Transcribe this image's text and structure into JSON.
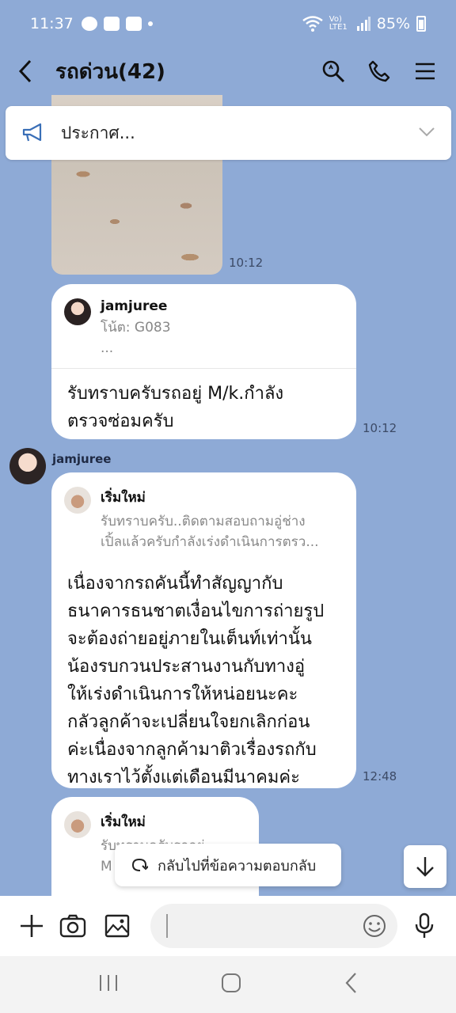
{
  "status_bar": {
    "time": "11:37",
    "battery": "85%",
    "network": "Vo) LTE1"
  },
  "header": {
    "title": "รถด่วน(42)",
    "icons": [
      "back-icon",
      "search-icon",
      "phone-icon",
      "menu-icon"
    ]
  },
  "announcement": {
    "label": "ประกาศ..."
  },
  "messages": [
    {
      "type": "image",
      "time": "10:12"
    },
    {
      "type": "reply",
      "reply_to": {
        "name": "jamjuree",
        "snippet_line1": "โน้ต: G083",
        "snippet_line2": "..."
      },
      "text_line1": "รับทราบครับรถอยู่ M/k.กำลัง",
      "text_line2": "ตรวจซ่อมครับ",
      "time": "10:12"
    },
    {
      "type": "reply",
      "sender": "jamjuree",
      "reply_to": {
        "name": "เริ่มใหม่",
        "snippet_line1": "รับทราบครับ..ติดตามสอบถามอู่ช่าง",
        "snippet_line2": "เปิ้ลแล้วครับกำลังเร่งดำเนินการตรว..."
      },
      "lines": [
        "เนื่องจากรถคันนี้ทำสัญญากับ",
        "ธนาคารธนชาตเงื่อนไขการถ่ายรูป",
        "จะต้องถ่ายอยู่ภายในเต็นท์เท่านั้น",
        "น้องรบกวนประสานงานกับทางอู่",
        "ให้เร่งดำเนินการให้หน่อยนะคะ",
        "กลัวลูกค้าจะเปลี่ยนใจยกเลิกก่อน",
        "ค่ะเนื่องจากลูกค้ามาติวเรื่องรถกับ",
        "ทางเราไว้ตั้งแต่เดือนมีนาคมค่ะ"
      ],
      "time": "12:48"
    },
    {
      "type": "reply",
      "reply_to": {
        "name": "เริ่มใหม่",
        "snippet_line1": "รับทราบครับรถอยู่",
        "snippet_line2": "M"
      }
    }
  ],
  "floating": {
    "jump_reply": "กลับไปที่ข้อความตอบกลับ"
  },
  "input": {
    "placeholder": ""
  }
}
